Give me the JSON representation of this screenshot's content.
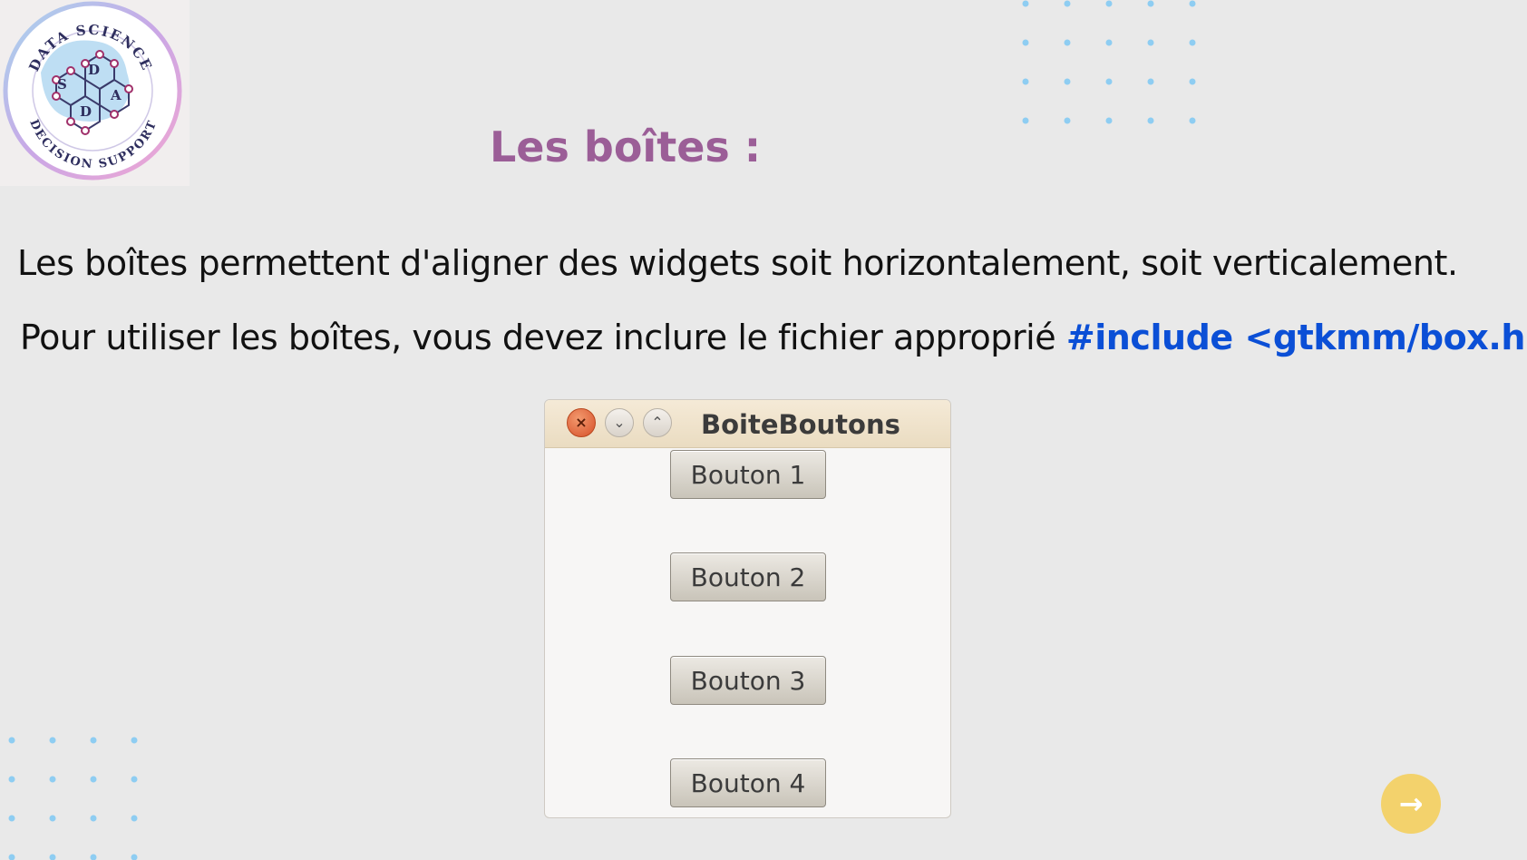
{
  "logo": {
    "top_text": "DATA SCIENCE",
    "bottom_text": "DECISION SUPPORT",
    "letters": [
      "S",
      "D",
      "A",
      "D"
    ]
  },
  "slide": {
    "title": "Les boîtes :",
    "line1": "Les boîtes permettent d'aligner des widgets soit horizontalement, soit verticalement.",
    "line2_text": "Pour utiliser les boîtes, vous devez inclure le fichier approprié ",
    "line2_code": "#include <gtkmm/box.h>"
  },
  "window": {
    "title": "BoiteBoutons",
    "close_glyph": "×",
    "minimize_glyph": "⌄",
    "maximize_glyph": "⌃",
    "buttons": [
      "Bouton 1",
      "Bouton 2",
      "Bouton 3",
      "Bouton 4"
    ]
  },
  "next_button": {
    "icon": "arrow-right-icon",
    "glyph": "→"
  },
  "colors": {
    "background": "#e9e9e9",
    "title": "#9b5e97",
    "code": "#0b4fd6",
    "dots": "#8ecdf2",
    "next_button": "#f3d26c"
  }
}
